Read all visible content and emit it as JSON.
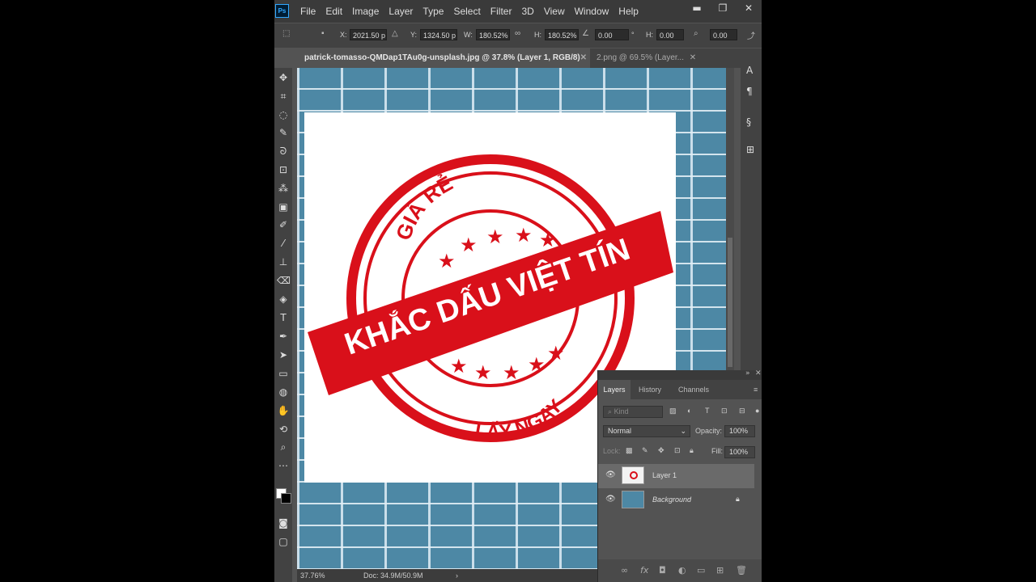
{
  "app": {
    "logo": "Ps",
    "menu": [
      "File",
      "Edit",
      "Image",
      "Layer",
      "Type",
      "Select",
      "Filter",
      "3D",
      "View",
      "Window",
      "Help"
    ],
    "window_controls": [
      "▬",
      "❐",
      "✕"
    ]
  },
  "options": {
    "x_label": "X:",
    "x_value": "2021.50 p",
    "y_label": "Y:",
    "y_value": "1324.50 p",
    "w_label": "W:",
    "w_value": "180.52%",
    "h_label": "H:",
    "h_value": "180.52%",
    "angle_value": "0.00",
    "angle_unit": "°",
    "hskew_label": "H:",
    "hskew_value": "0.00",
    "vskew_value": "0.00"
  },
  "tabs": {
    "active": "patrick-tomasso-QMDap1TAu0g-unsplash.jpg @ 37.8% (Layer 1, RGB/8)",
    "active_close": "✕",
    "inactive": "2.png @ 69.5% (Layer...",
    "inactive_close": "✕"
  },
  "stamp": {
    "top_text": "GIÁ RẺ",
    "banner_text": "KHẮC DẤU VIỆT TÍN",
    "bottom_text": "LẤY NGAY",
    "color": "#d9101a"
  },
  "status": {
    "zoom": "37.76%",
    "doc": "Doc: 34.9M/50.9M",
    "arrow": "›"
  },
  "layers_panel": {
    "tabs": [
      "Layers",
      "History",
      "Channels"
    ],
    "kind_placeholder": "Kind",
    "blend_mode": "Normal",
    "opacity_label": "Opacity:",
    "opacity_value": "100%",
    "lock_label": "Lock:",
    "fill_label": "Fill:",
    "fill_value": "100%",
    "layers": [
      {
        "name": "Layer 1",
        "selected": true
      },
      {
        "name": "Background",
        "selected": false,
        "locked": true
      }
    ]
  },
  "colors": {
    "accent": "#31a8ff",
    "stamp_red": "#d9101a",
    "brick_blue": "#4d88a5"
  }
}
